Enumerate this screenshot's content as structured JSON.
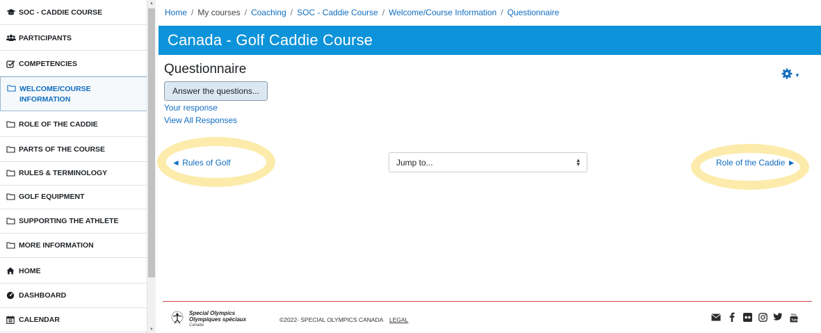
{
  "sidebar": {
    "items": [
      {
        "label": "SOC - CADDIE COURSE",
        "icon": "graduation-cap-icon"
      },
      {
        "label": "PARTICIPANTS",
        "icon": "users-icon"
      },
      {
        "label": "COMPETENCIES",
        "icon": "checkbox-icon"
      },
      {
        "label": "WELCOME/COURSE INFORMATION",
        "icon": "folder-icon",
        "active": true
      },
      {
        "label": "ROLE OF THE CADDIE",
        "icon": "folder-icon"
      },
      {
        "label": "PARTS OF THE COURSE",
        "icon": "folder-icon"
      },
      {
        "label": "RULES & TERMINOLOGY",
        "icon": "folder-icon"
      },
      {
        "label": "GOLF EQUIPMENT",
        "icon": "folder-icon"
      },
      {
        "label": "SUPPORTING THE ATHLETE",
        "icon": "folder-icon"
      },
      {
        "label": "MORE INFORMATION",
        "icon": "folder-icon"
      },
      {
        "label": "HOME",
        "icon": "home-icon"
      },
      {
        "label": "DASHBOARD",
        "icon": "dashboard-icon"
      },
      {
        "label": "CALENDAR",
        "icon": "calendar-icon"
      }
    ]
  },
  "breadcrumb": [
    "Home",
    "My courses",
    "Coaching",
    "SOC - Caddie Course",
    "Welcome/Course Information",
    "Questionnaire"
  ],
  "course_title": "Canada - Golf Caddie Course",
  "page_title": "Questionnaire",
  "answer_button": "Answer the questions...",
  "links": {
    "your_response": "Your response",
    "view_all": "View All Responses"
  },
  "nav": {
    "prev": "◄ Rules of Golf",
    "next": "Role of the Caddie ►",
    "jump_placeholder": "Jump to..."
  },
  "footer": {
    "logo_line1": "Special Olympics",
    "logo_line2": "Olympiques spéciaux",
    "logo_line3": "Canada",
    "copyright": "©2022- SPECIAL OLYMPICS CANADA",
    "legal": "LEGAL",
    "social_icons": [
      "email-icon",
      "facebook-icon",
      "flickr-icon",
      "instagram-icon",
      "twitter-icon",
      "youtube-icon"
    ]
  },
  "colors": {
    "banner": "#0d93d9",
    "link": "#0f6cbf",
    "highlight": "#fbe89b",
    "footer_rule": "#c9444a"
  }
}
